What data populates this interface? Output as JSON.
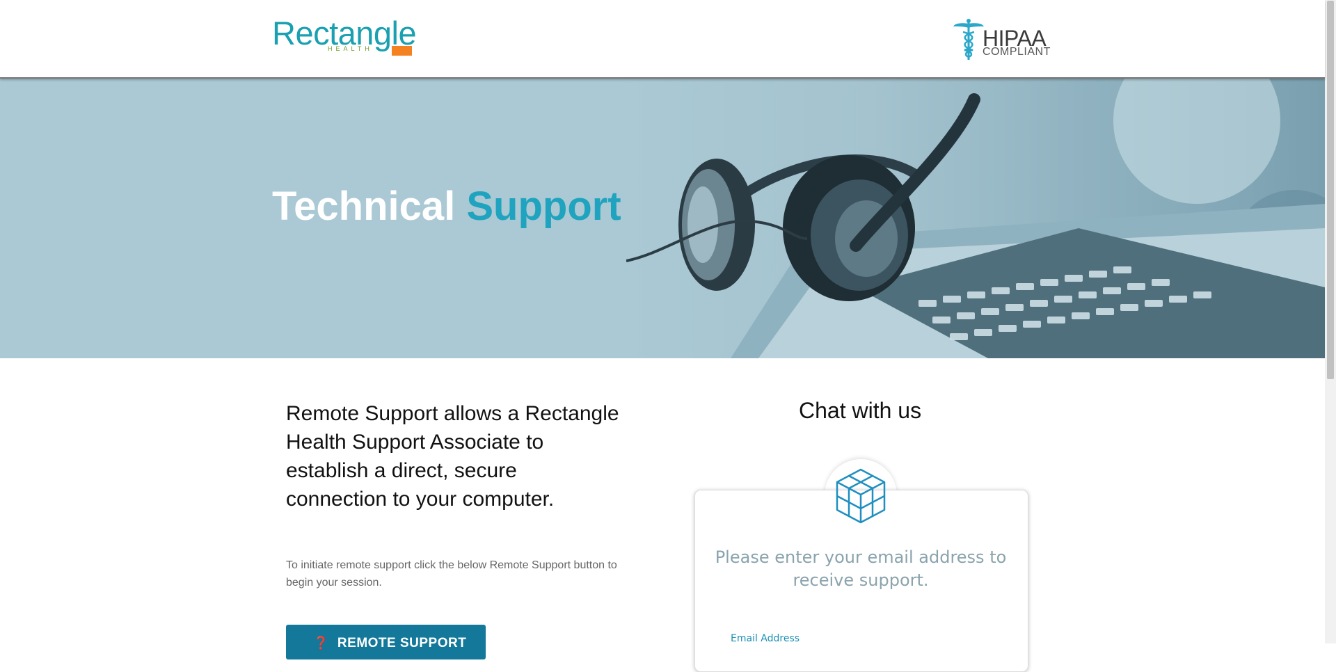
{
  "header": {
    "logo": {
      "name": "Rectangle",
      "sub": "HEALTH"
    },
    "hipaa": {
      "title": "HIPAA",
      "subtitle": "COMPLIANT"
    }
  },
  "hero": {
    "title_main": "Technical",
    "title_accent": "Support"
  },
  "main": {
    "intro": "Remote Support allows a Rectangle Health Support Associate to establish a direct, secure connection to your computer.",
    "note": "To initiate remote support click the below Remote Support button to begin your session.",
    "remote_button": {
      "label": "REMOTE SUPPORT",
      "icon": "question-circle-icon"
    }
  },
  "chat": {
    "title": "Chat with us",
    "prompt": "Please enter your email address to receive support.",
    "email_label": "Email Address",
    "icon": "hex-cube-icon"
  },
  "colors": {
    "brand_teal": "#1aa0b0",
    "accent_support": "#1fa3be",
    "button_bg": "#13789a",
    "hero_bg": "#aac9d4",
    "logo_orange": "#f58220",
    "prompt_text": "#8aa3ad"
  }
}
